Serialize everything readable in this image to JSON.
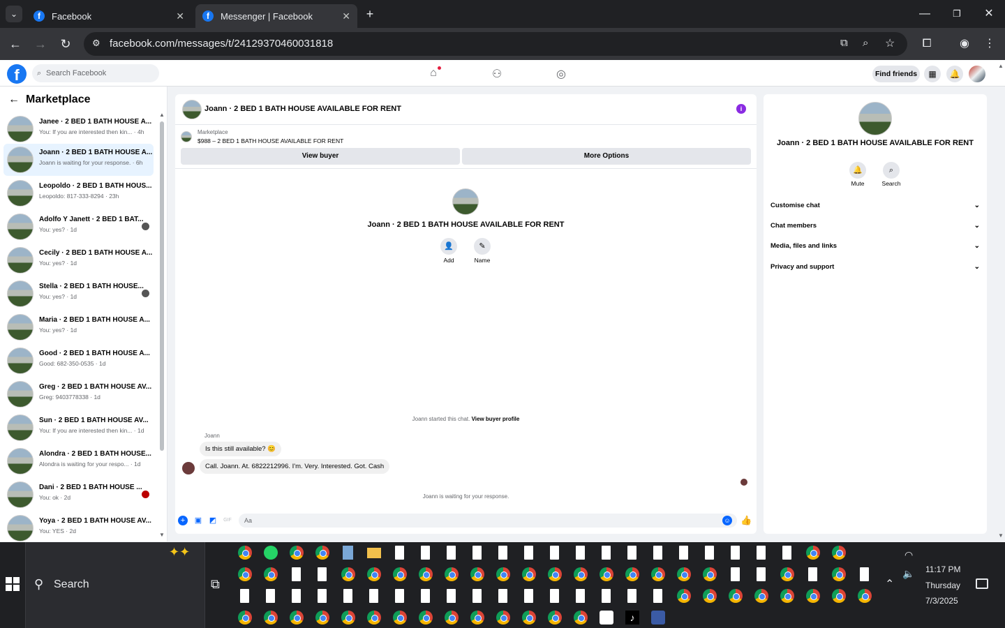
{
  "browser": {
    "tabs": [
      {
        "title": "Facebook",
        "active": false
      },
      {
        "title": "Messenger | Facebook",
        "active": true
      }
    ],
    "url": "facebook.com/messages/t/24129370460031818"
  },
  "fb_header": {
    "search_placeholder": "Search Facebook",
    "find_friends": "Find friends"
  },
  "left_panel": {
    "title": "Marketplace",
    "conversations": [
      {
        "name": "Janee · 2 BED 1 BATH HOUSE A...",
        "preview": "You: If you are interested then kin... · 4h"
      },
      {
        "name": "Joann · 2 BED 1 BATH HOUSE A...",
        "preview": "Joann is waiting for your response. · 6h"
      },
      {
        "name": "Leopoldo · 2 BED 1 BATH HOUS...",
        "preview": "Leopoldo: 817-333-8294 · 23h"
      },
      {
        "name": "Adolfo Y Janett · 2 BED 1 BAT...",
        "preview": "You: yes? · 1d"
      },
      {
        "name": "Cecily · 2 BED 1 BATH HOUSE A...",
        "preview": "You: yes? · 1d"
      },
      {
        "name": "Stella · 2 BED 1 BATH HOUSE...",
        "preview": "You: yes? · 1d"
      },
      {
        "name": "Maria · 2 BED 1 BATH HOUSE A...",
        "preview": "You: yes? · 1d"
      },
      {
        "name": "Good · 2 BED 1 BATH HOUSE A...",
        "preview": "Good: 682-350-0535 · 1d"
      },
      {
        "name": "Greg · 2 BED 1 BATH HOUSE AV...",
        "preview": "Greg: 9403778338 · 1d"
      },
      {
        "name": "Sun · 2 BED 1 BATH HOUSE AV...",
        "preview": "You: If you are interested then kin... · 1d"
      },
      {
        "name": "Alondra · 2 BED 1 BATH HOUSE...",
        "preview": "Alondra is waiting for your respo... · 1d"
      },
      {
        "name": "Dani · 2 BED 1 BATH HOUSE ...",
        "preview": "You: ok · 2d"
      },
      {
        "name": "Yoya · 2 BED 1 BATH HOUSE AV...",
        "preview": "You: YES · 2d"
      }
    ]
  },
  "chat": {
    "title": "Joann · 2 BED 1 BATH HOUSE AVAILABLE FOR RENT",
    "marketplace_label": "Marketplace",
    "listing": "$988 – 2 BED 1 BATH HOUSE AVAILABLE FOR RENT",
    "view_buyer": "View buyer",
    "more_options": "More Options",
    "center_name": "Joann · 2 BED 1 BATH HOUSE AVAILABLE FOR RENT",
    "add_label": "Add",
    "name_label": "Name",
    "started_text": "Joann started this chat.",
    "view_buyer_profile": "View buyer profile",
    "sender": "Joann",
    "messages": [
      "Is this still available? 😊",
      "Call. Joann.  At. 6822212996. I'm. Very.  Interested.  Got. Cash"
    ],
    "waiting": "Joann is waiting for your response.",
    "composer_placeholder": "Aa"
  },
  "right_panel": {
    "name": "Joann · 2 BED 1 BATH HOUSE AVAILABLE FOR RENT",
    "mute": "Mute",
    "search": "Search",
    "sections": [
      "Customise chat",
      "Chat members",
      "Media, files and links",
      "Privacy and support"
    ]
  },
  "taskbar": {
    "search_label": "Search",
    "time": "11:17 PM",
    "day": "Thursday",
    "date": "7/3/2025"
  },
  "colors": {
    "fb_blue": "#1877f2",
    "messenger_blue": "#0866ff",
    "selected_row": "#e7f3ff"
  }
}
